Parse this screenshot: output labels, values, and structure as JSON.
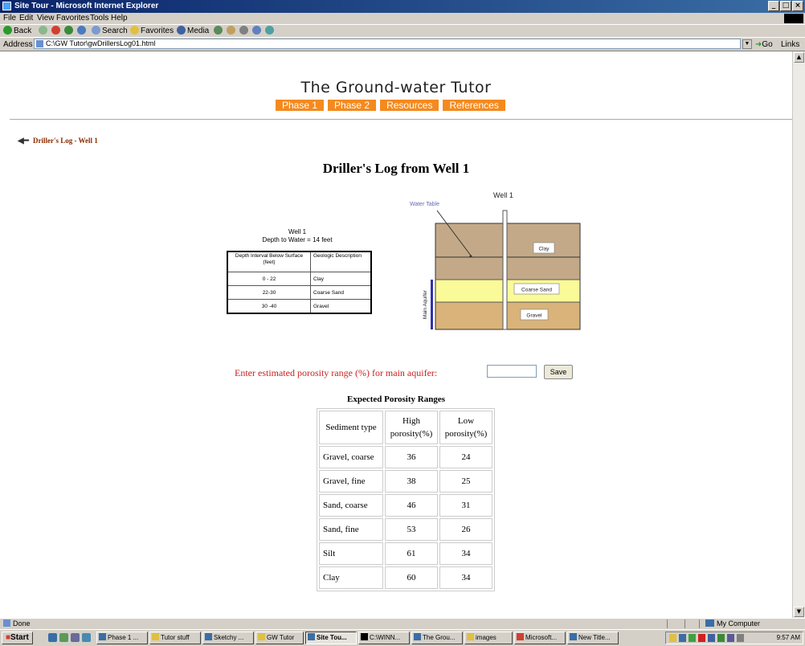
{
  "window": {
    "title": "Site Tour - Microsoft Internet Explorer",
    "minimize": "_",
    "maximize": "□",
    "close": "×"
  },
  "menu": [
    "File",
    "Edit",
    "View",
    "Favorites",
    "Tools",
    "Help"
  ],
  "toolbar": {
    "back": "Back",
    "search": "Search",
    "favorites": "Favorites",
    "media": "Media"
  },
  "address": {
    "label": "Address",
    "value": "C:\\GW Tutor\\gwDrillersLog01.html",
    "go": "Go",
    "links": "Links"
  },
  "site": {
    "title": "The Ground-water Tutor",
    "nav": [
      "Phase 1",
      "Phase 2",
      "Resources",
      "References"
    ]
  },
  "breadcrumb": "Driller's Log - Well 1",
  "heading": "Driller's Log from Well 1",
  "well_log": {
    "caption_line1": "Well 1",
    "caption_line2": "Depth to Water = 14 feet",
    "headers": [
      "Depth Interval Below Surface (feet)",
      "Geologic Description"
    ],
    "rows": [
      [
        "0 - 22",
        "Clay"
      ],
      [
        "22-30",
        "Coarse Sand"
      ],
      [
        "30 -40",
        "Gravel"
      ]
    ]
  },
  "diagram": {
    "well_label": "Well 1",
    "water_table_label": "Water Table",
    "aquifer_label": "Main Aquifer",
    "layers": [
      "Clay",
      "Coarse Sand",
      "Gravel"
    ],
    "colors": {
      "clay": "#c4a988",
      "sand": "#fafa98",
      "gravel": "#d9b37a",
      "aquifer": "#3333aa"
    }
  },
  "porosity": {
    "prompt": "Enter estimated porosity range (%) for main aquifer:",
    "input_value": "",
    "save": "Save"
  },
  "expected": {
    "title": "Expected Porosity Ranges",
    "headers": [
      "Sediment type",
      "High porosity(%)",
      "Low porosity(%)"
    ],
    "rows": [
      [
        "Gravel, coarse",
        "36",
        "24"
      ],
      [
        "Gravel, fine",
        "38",
        "25"
      ],
      [
        "Sand, coarse",
        "46",
        "31"
      ],
      [
        "Sand, fine",
        "53",
        "26"
      ],
      [
        "Silt",
        "61",
        "34"
      ],
      [
        "Clay",
        "60",
        "34"
      ]
    ]
  },
  "status": {
    "text": "Done",
    "zone": "My Computer"
  },
  "taskbar": {
    "start": "Start",
    "tasks": [
      "Phase 1 ...",
      "Tutor stuff",
      "Sketchy ...",
      "GW Tutor",
      "Site Tou...",
      "C:\\WINN...",
      "The Grou...",
      "images",
      "Microsoft...",
      "New Title..."
    ],
    "clock": "9:57 AM"
  },
  "accent": {
    "orange": "#f48a1f",
    "prompt_red": "#cc1f1f"
  }
}
